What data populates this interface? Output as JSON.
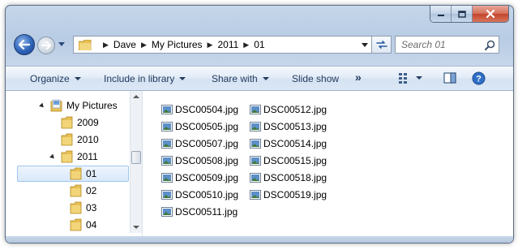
{
  "window": {
    "caption_buttons": [
      "minimize-icon",
      "maximize-icon",
      "close-icon"
    ]
  },
  "navigation": {
    "back_icon": "back-arrow-icon",
    "forward_icon": "forward-arrow-icon",
    "recent_dropdown_icon": "chevron-down-icon"
  },
  "address": {
    "crumbs": [
      "Dave",
      "My Pictures",
      "2011",
      "01"
    ],
    "separator": "▶"
  },
  "search": {
    "placeholder": "Search 01"
  },
  "commandbar": {
    "organize": "Organize",
    "include_in_library": "Include in library",
    "share_with": "Share with",
    "slide_show": "Slide show",
    "more": "»"
  },
  "navtree": {
    "items": [
      {
        "label": "My Pictures",
        "level": 0,
        "expanded": true
      },
      {
        "label": "2009",
        "level": 1
      },
      {
        "label": "2010",
        "level": 1
      },
      {
        "label": "2011",
        "level": 1,
        "expanded": true
      },
      {
        "label": "01",
        "level": 2,
        "selected": true
      },
      {
        "label": "02",
        "level": 2
      },
      {
        "label": "03",
        "level": 2
      },
      {
        "label": "04",
        "level": 2
      }
    ]
  },
  "files": {
    "column1": [
      "DSC00504.jpg",
      "DSC00505.jpg",
      "DSC00507.jpg",
      "DSC00508.jpg",
      "DSC00509.jpg",
      "DSC00510.jpg",
      "DSC00511.jpg"
    ],
    "column2": [
      "DSC00512.jpg",
      "DSC00513.jpg",
      "DSC00514.jpg",
      "DSC00515.jpg",
      "DSC00518.jpg",
      "DSC00519.jpg"
    ]
  },
  "colors": {
    "accent": "#1e395b",
    "selection": "#d8e8fa",
    "folder": "#e8c35a"
  }
}
